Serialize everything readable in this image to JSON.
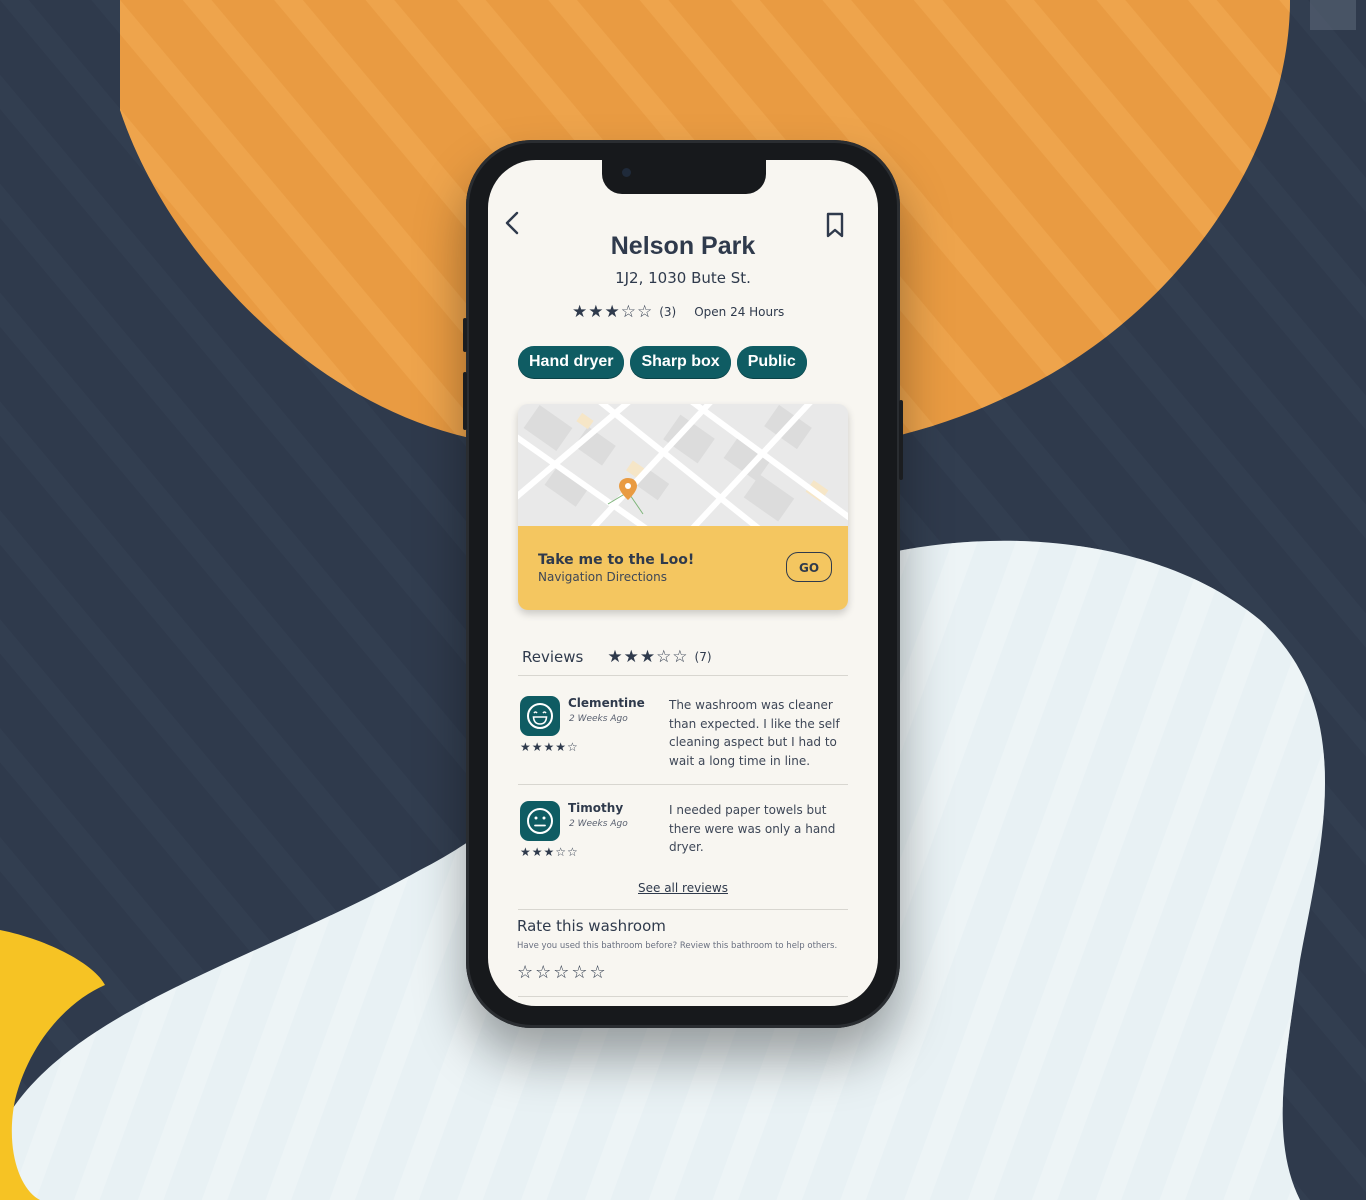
{
  "place": {
    "name": "Nelson Park",
    "address": "1J2, 1030 Bute St.",
    "stars": "★★★☆☆",
    "rating_count": "(3)",
    "hours": "Open 24 Hours"
  },
  "tags": [
    "Hand dryer",
    "Sharp box",
    "Public"
  ],
  "navigation": {
    "title": "Take me to the Loo!",
    "subtitle": "Navigation Directions",
    "go_label": "GO"
  },
  "reviews": {
    "label": "Reviews",
    "stars": "★★★☆☆",
    "count": "(7)",
    "items": [
      {
        "name": "Clementine",
        "date": "2 Weeks Ago",
        "stars": "★★★★☆",
        "text": "The washroom was cleaner than expected. I like the self cleaning aspect but I had to wait a long time in line."
      },
      {
        "name": "Timothy",
        "date": "2 Weeks Ago",
        "stars": "★★★☆☆",
        "text": "I needed paper towels but there were was only a hand dryer."
      }
    ],
    "see_all": "See all reviews"
  },
  "rate": {
    "title": "Rate this washroom",
    "subtitle": "Have you used this bathroom before? Review this bathroom to help others.",
    "stars": "☆☆☆☆☆"
  },
  "colors": {
    "background": "#2f3a4c",
    "orange_blob": "#e99b42",
    "light_blob": "#e8f1f4",
    "yellow_blob": "#f6c324",
    "brand_teal": "#0f5c63",
    "nav_card": "#f4c660",
    "text_dark": "#2f3a4c"
  },
  "icons": [
    "back-chevron-icon",
    "bookmark-icon",
    "map-pin-icon",
    "smiley-happy-icon",
    "smiley-neutral-icon"
  ]
}
